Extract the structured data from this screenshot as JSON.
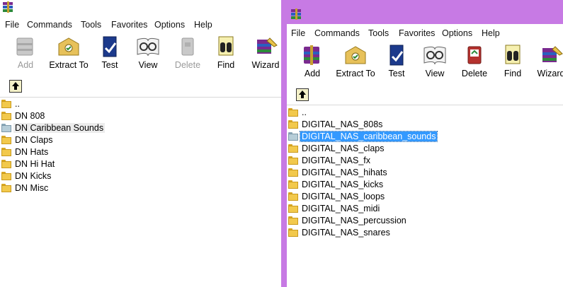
{
  "left": {
    "menu": [
      "File",
      "Commands",
      "Tools",
      "Favorites",
      "Options",
      "Help"
    ],
    "tools": [
      {
        "label": "Add",
        "disabled": true,
        "icon": "add-archive-icon"
      },
      {
        "label": "Extract To",
        "disabled": false,
        "icon": "extract-to-icon"
      },
      {
        "label": "Test",
        "disabled": false,
        "icon": "test-icon"
      },
      {
        "label": "View",
        "disabled": false,
        "icon": "view-icon"
      },
      {
        "label": "Delete",
        "disabled": true,
        "icon": "delete-icon"
      },
      {
        "label": "Find",
        "disabled": false,
        "icon": "find-icon"
      },
      {
        "label": "Wizard",
        "disabled": false,
        "icon": "wizard-icon"
      }
    ],
    "files": [
      "..",
      "DN 808",
      "DN Caribbean Sounds",
      "DN Claps",
      "DN Hats",
      "DN Hi Hat",
      "DN Kicks",
      "DN Misc"
    ],
    "highlighted_index": 2
  },
  "right": {
    "menu": [
      "File",
      "Commands",
      "Tools",
      "Favorites",
      "Options",
      "Help"
    ],
    "tools": [
      {
        "label": "Add",
        "disabled": false,
        "icon": "add-archive-icon"
      },
      {
        "label": "Extract To",
        "disabled": false,
        "icon": "extract-to-icon"
      },
      {
        "label": "Test",
        "disabled": false,
        "icon": "test-icon"
      },
      {
        "label": "View",
        "disabled": false,
        "icon": "view-icon"
      },
      {
        "label": "Delete",
        "disabled": false,
        "icon": "delete-icon"
      },
      {
        "label": "Find",
        "disabled": false,
        "icon": "find-icon"
      },
      {
        "label": "Wizard",
        "disabled": false,
        "icon": "wizard-icon"
      }
    ],
    "files": [
      "..",
      "DIGITAL_NAS_808s",
      "DIGITAL_NAS_caribbean_sounds",
      "DIGITAL_NAS_claps",
      "DIGITAL_NAS_fx",
      "DIGITAL_NAS_hihats",
      "DIGITAL_NAS_kicks",
      "DIGITAL_NAS_loops",
      "DIGITAL_NAS_midi",
      "DIGITAL_NAS_percussion",
      "DIGITAL_NAS_snares"
    ],
    "selected_index": 2
  },
  "colors": {
    "title_accent": "#c77ae4",
    "selection": "#3399ff",
    "hover_row": "#ececec"
  }
}
